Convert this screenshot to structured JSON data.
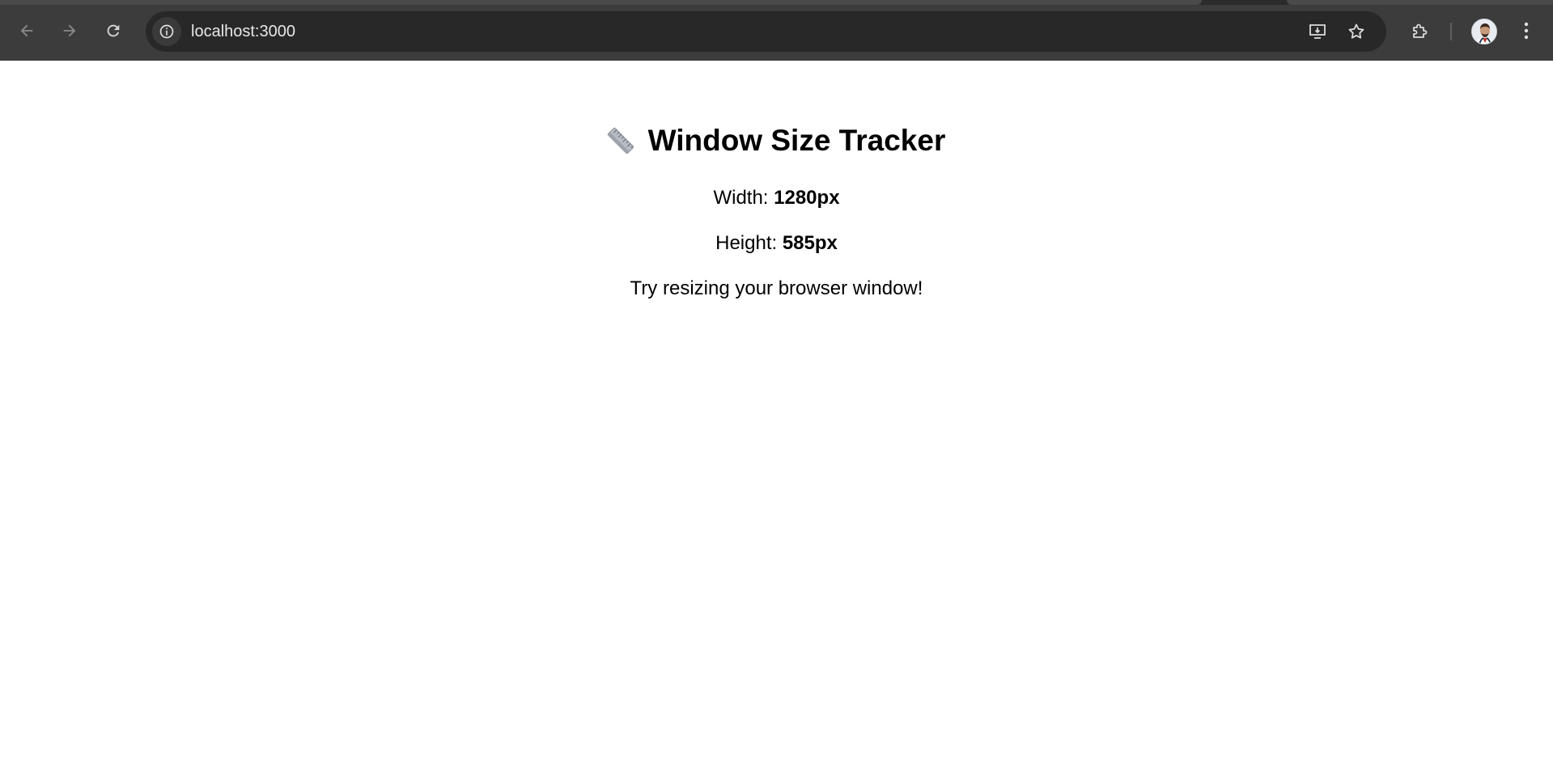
{
  "browser": {
    "url": "localhost:3000",
    "icons": {
      "back": "back-arrow-icon",
      "forward": "forward-arrow-icon",
      "reload": "reload-icon",
      "site_info": "info-icon",
      "install": "install-app-icon",
      "bookmark": "star-icon",
      "extensions": "puzzle-icon",
      "menu": "kebab-menu-icon"
    }
  },
  "page": {
    "title": "Window Size Tracker",
    "title_icon": "ruler-icon",
    "width_label": "Width: ",
    "width_value": "1280px",
    "height_label": "Height: ",
    "height_value": "585px",
    "hint": "Try resizing your browser window!"
  }
}
